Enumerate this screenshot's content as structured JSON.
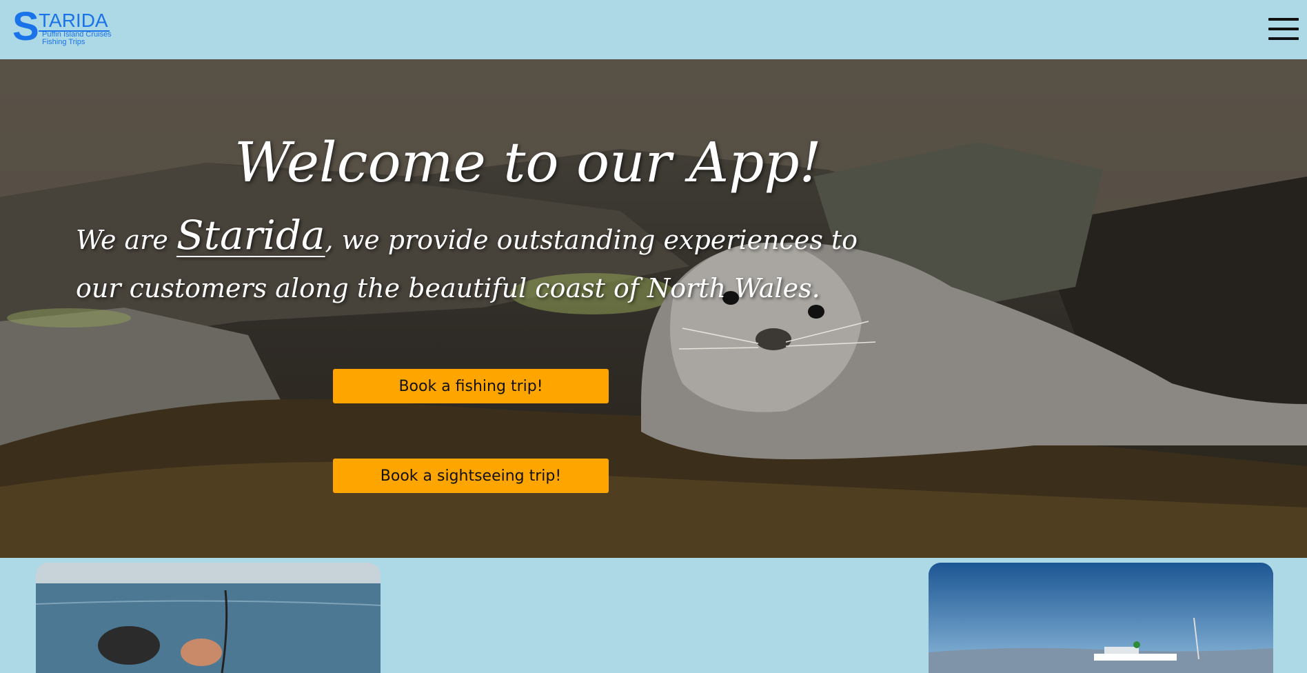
{
  "header": {
    "logo": {
      "letter": "S",
      "word": "TARIDA",
      "tagline_lines": [
        "Puffin Island Cruises",
        "Fishing Trips"
      ]
    },
    "menu_icon": "hamburger-menu-icon"
  },
  "hero": {
    "background_image": "grey seal resting on seaweed-covered rocks",
    "title": "Welcome to our App!",
    "tagline": {
      "prefix": "We are ",
      "brand": "Starida",
      "suffix": ", we provide outstanding experiences to our customers along the beautiful coast of North Wales."
    },
    "buttons": {
      "fishing": "Book a fishing trip!",
      "sightseeing": "Book a sightseeing trip!"
    }
  },
  "cards": {
    "left_image": "person fishing at sea",
    "right_image": "boat at harbour under blue sky"
  },
  "colors": {
    "page_background": "#ADD8E6",
    "logo_blue": "#1a73e8",
    "button_orange": "#FFA500"
  }
}
